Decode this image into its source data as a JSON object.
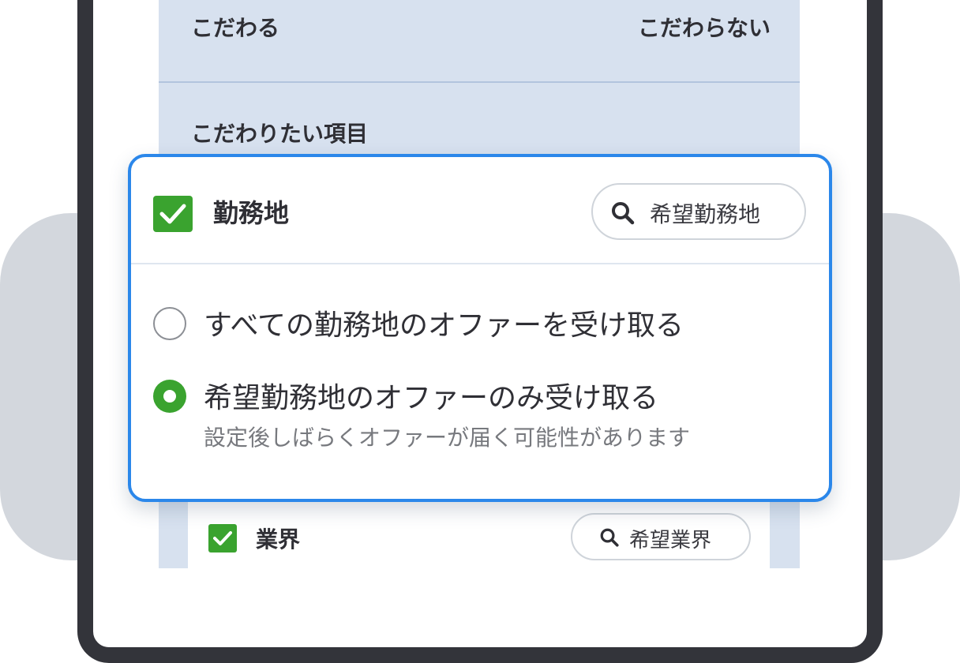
{
  "preference": {
    "left_label": "こだわる",
    "right_label": "こだわらない"
  },
  "section": {
    "title": "こだわりたい項目"
  },
  "work_location": {
    "checked": true,
    "title": "勤務地",
    "search_label": "希望勤務地",
    "options": [
      {
        "label": "すべての勤務地のオファーを受け取る",
        "selected": false
      },
      {
        "label": "希望勤務地のオファーのみ受け取る",
        "selected": true,
        "note": "設定後しばらくオファーが届く可能性があります"
      }
    ]
  },
  "industry": {
    "checked": true,
    "title": "業界",
    "search_label": "希望業界"
  },
  "colors": {
    "accent_blue": "#2b87ea",
    "check_green": "#3aa32f",
    "panel_bg": "#d7e1ef"
  }
}
